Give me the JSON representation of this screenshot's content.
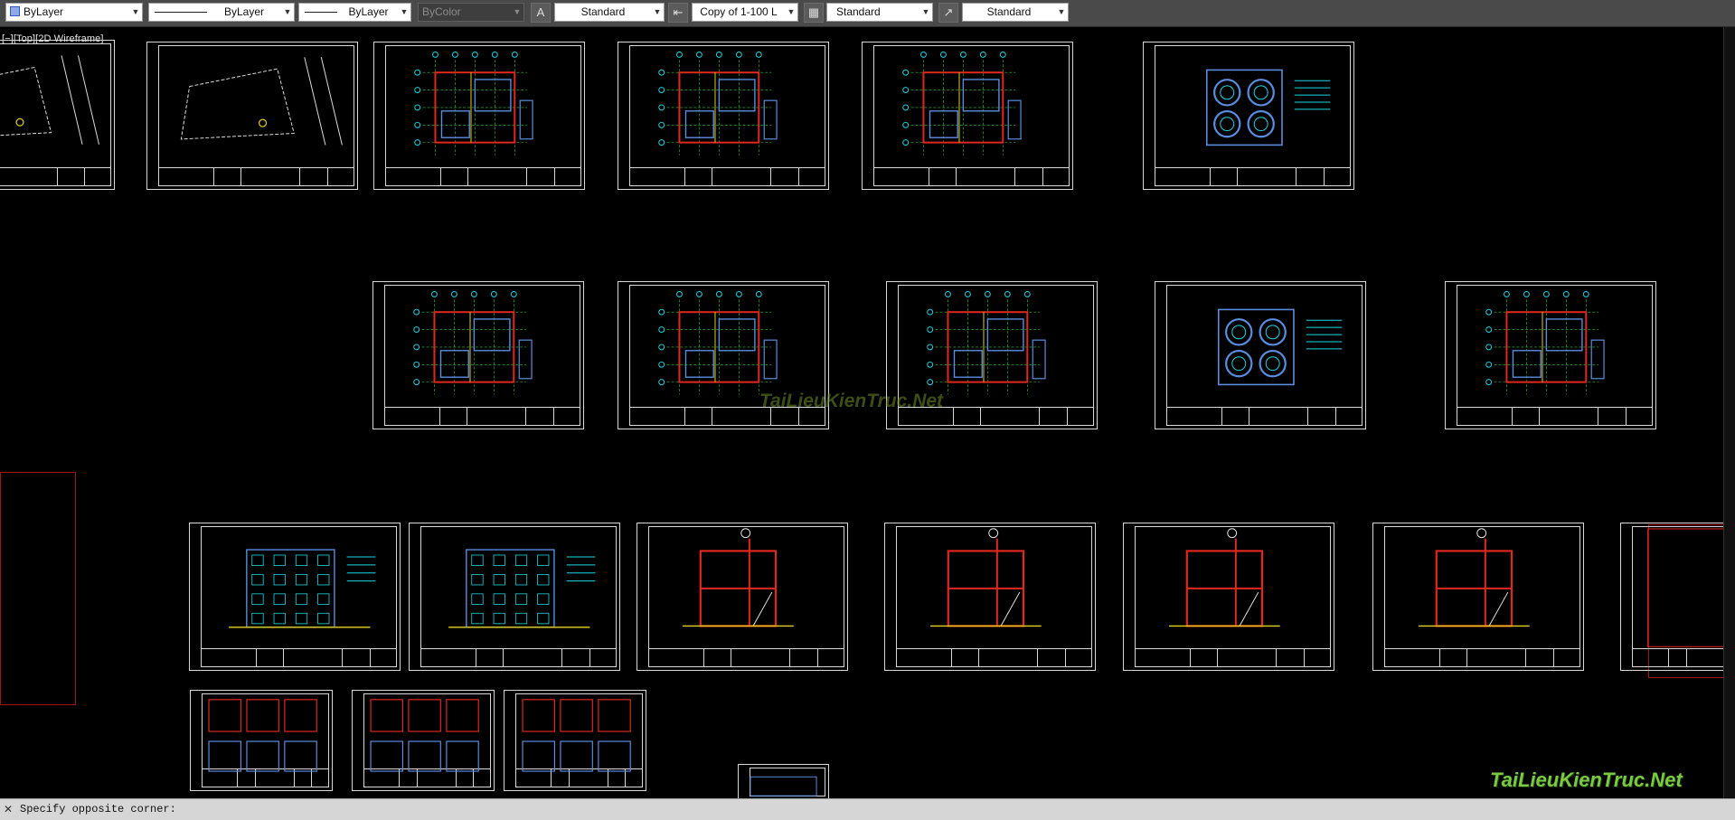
{
  "toolbar": {
    "color_combo": "ByLayer",
    "linetype_combo": "ByLayer",
    "lineweight_combo": "ByLayer",
    "plotstyle_combo": "ByColor",
    "text_style_combo": "Standard",
    "dim_style_combo": "Copy of 1-100 L",
    "table_style_combo": "Standard",
    "mleader_style_combo": "Standard"
  },
  "icons": {
    "text_style": "text-style-icon",
    "dim_style": "dimension-style-icon",
    "table_style": "table-style-icon",
    "mleader_style": "multileader-style-icon"
  },
  "viewport": {
    "label": "[−][Top][2D Wireframe]"
  },
  "watermark": {
    "center": "TaiLieuKienTruc.Net",
    "corner": "TaiLieuKienTruc.Net"
  },
  "command_line": {
    "prompt": "Specify opposite corner:"
  },
  "colors": {
    "background": "#000000",
    "sheet_border": "#d8d8d8",
    "cad_cyan": "#19d9e6",
    "cad_red": "#e0281e",
    "cad_blue": "#5b8ee0",
    "cad_yellow": "#e6d21c",
    "cad_green": "#2ecc40",
    "toolbar": "#4a4a4a"
  }
}
